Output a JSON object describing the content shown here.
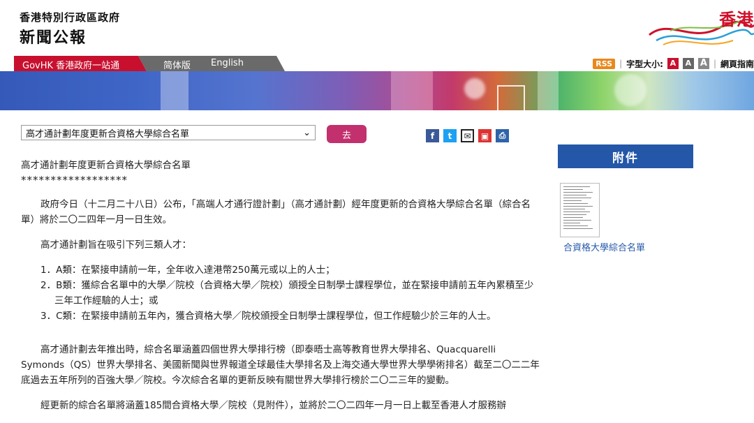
{
  "header": {
    "org_name": "香港特別行政區政府",
    "site_name": "新聞公報",
    "brand_text": "香港"
  },
  "nav": {
    "govhk": "GovHK 香港政府一站通",
    "simplified": "简体版",
    "english": "English"
  },
  "tools": {
    "rss": "RSS",
    "font_size_label": "字型大小:",
    "font_small": "A",
    "font_medium": "A",
    "font_large": "A",
    "web_guide": "網頁指南"
  },
  "toolbar": {
    "topic_select_value": "高才通計劃年度更新合資格大學綜合名單",
    "go_label": "去"
  },
  "article": {
    "title": "高才通計劃年度更新合資格大學綜合名單",
    "stars": "******************",
    "p1": "政府今日（十二月二十八日）公布，「高端人才通行證計劃」（高才通計劃）經年度更新的合資格大學綜合名單（綜合名單）將於二〇二四年一月一日生效。",
    "p2": "高才通計劃旨在吸引下列三類人才：",
    "items": [
      "1．A類：在緊接申請前一年，全年收入達港幣250萬元或以上的人士；",
      "2．B類：獲綜合名單中的大學／院校（合資格大學／院校）頒授全日制學士課程學位，並在緊接申請前五年內累積至少三年工作經驗的人士；或",
      "3．C類：在緊接申請前五年內，獲合資格大學／院校頒授全日制學士課程學位，但工作經驗少於三年的人士。"
    ],
    "p3": "高才通計劃去年推出時，綜合名單涵蓋四個世界大學排行榜（即泰晤士高等教育世界大學排名、Quacquarelli Symonds（QS）世界大學排名、美國新聞與世界報道全球最佳大學排名及上海交通大學世界大學學術排名）截至二〇二二年底過去五年所列的百強大學／院校。今次綜合名單的更新反映有關世界大學排行榜於二〇二三年的變動。",
    "p4": "經更新的綜合名單將涵蓋185間合資格大學／院校（見附件），並將於二〇二四年一月一日上載至香港人才服務辦"
  },
  "sidebar": {
    "attachment_heading": "附件",
    "attachment_link": "合資格大學綜合名單"
  },
  "icons": [
    "facebook-icon",
    "twitter-icon",
    "email-icon",
    "save-icon",
    "print-icon",
    "dropdown-chevron-icon"
  ],
  "colors": {
    "nav_red": "#c8102e",
    "go_button": "#c2306e",
    "attachment_blue": "#2457a8",
    "rss_orange": "#e8891e"
  }
}
